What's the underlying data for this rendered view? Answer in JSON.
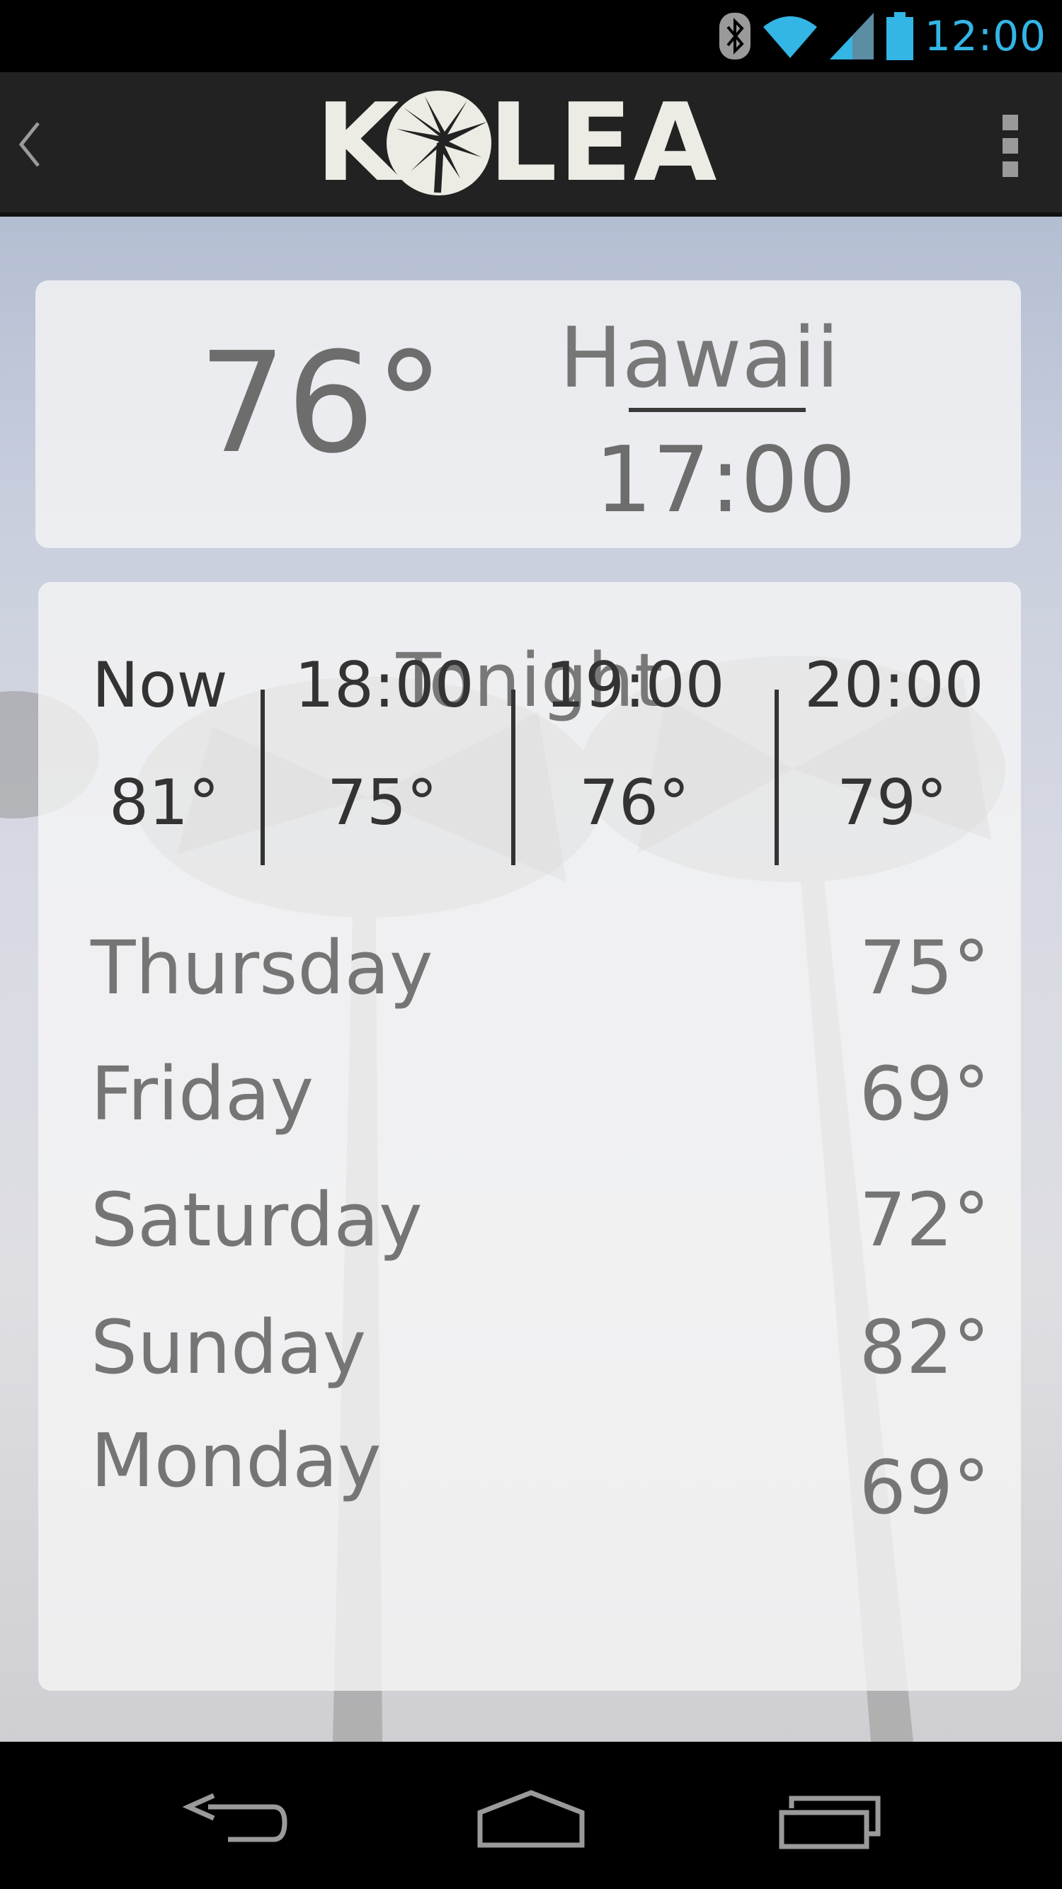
{
  "status_bar": {
    "time": "12:00",
    "icons": [
      "bluetooth-icon",
      "wifi-icon",
      "cell-signal-icon",
      "battery-icon"
    ],
    "accent_color": "#33b5e5"
  },
  "action_bar": {
    "logo_text": "KOLEA",
    "back_icon": "chevron-left-icon",
    "menu_icon": "overflow-menu-icon"
  },
  "current": {
    "temperature": "76°",
    "location": "Hawaii",
    "local_time": "17:00"
  },
  "forecast": {
    "title": "Tonight",
    "hourly": [
      {
        "label": "Now",
        "temp": "81°"
      },
      {
        "label": "18:00",
        "temp": "75°"
      },
      {
        "label": "19:00",
        "temp": "76°"
      },
      {
        "label": "20:00",
        "temp": "79°"
      }
    ],
    "daily": [
      {
        "day": "Thursday",
        "temp": "75°"
      },
      {
        "day": "Friday",
        "temp": "69°"
      },
      {
        "day": "Saturday",
        "temp": "72°"
      },
      {
        "day": "Sunday",
        "temp": "82°"
      },
      {
        "day": "Monday",
        "temp": "69°"
      }
    ]
  },
  "nav_bar": {
    "icons": [
      "back-nav-icon",
      "home-nav-icon",
      "recents-nav-icon"
    ]
  }
}
